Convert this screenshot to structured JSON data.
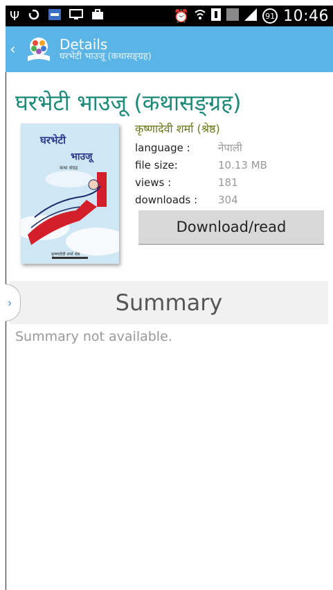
{
  "status_bar": {
    "time": "10:46",
    "battery": "91",
    "icons": [
      "usb-icon",
      "sync-icon",
      "app-notification-icon",
      "monitor-icon",
      "briefcase-icon",
      "alarm-icon",
      "wifi-icon",
      "sim-icon",
      "data-icon",
      "signal-icon",
      "battery-icon"
    ]
  },
  "action_bar": {
    "title": "Details",
    "subtitle": "घरभेटी भाउजू (कथासङ्ग्रह)",
    "back_icon": "chevron-left-icon",
    "logo_icon": "app-logo-icon"
  },
  "book": {
    "title": "घरभेटी भाउजू (कथासङ्ग्रह)",
    "author": "कृष्णादेवी शर्मा (श्रेष्ठ)",
    "cover_title_line1": "घरभेटी",
    "cover_title_line2": "भाउजू",
    "cover_sub": "कथा संग्रह",
    "cover_author": "कृष्णादेवी शर्मा श्रेष्ठ",
    "meta": [
      {
        "label": "language :",
        "value": "नेपाली"
      },
      {
        "label": "file size:",
        "value": "10.13 MB"
      },
      {
        "label": "views :",
        "value": "181"
      },
      {
        "label": "downloads :",
        "value": "304"
      }
    ]
  },
  "download_button": "Download/read",
  "summary": {
    "heading": "Summary",
    "text": "Summary not available.",
    "drawer_icon": "chevron-right-icon"
  },
  "colors": {
    "action_bar": "#5ab4e6",
    "title": "#1d8a7a",
    "author": "#6a7a16"
  }
}
